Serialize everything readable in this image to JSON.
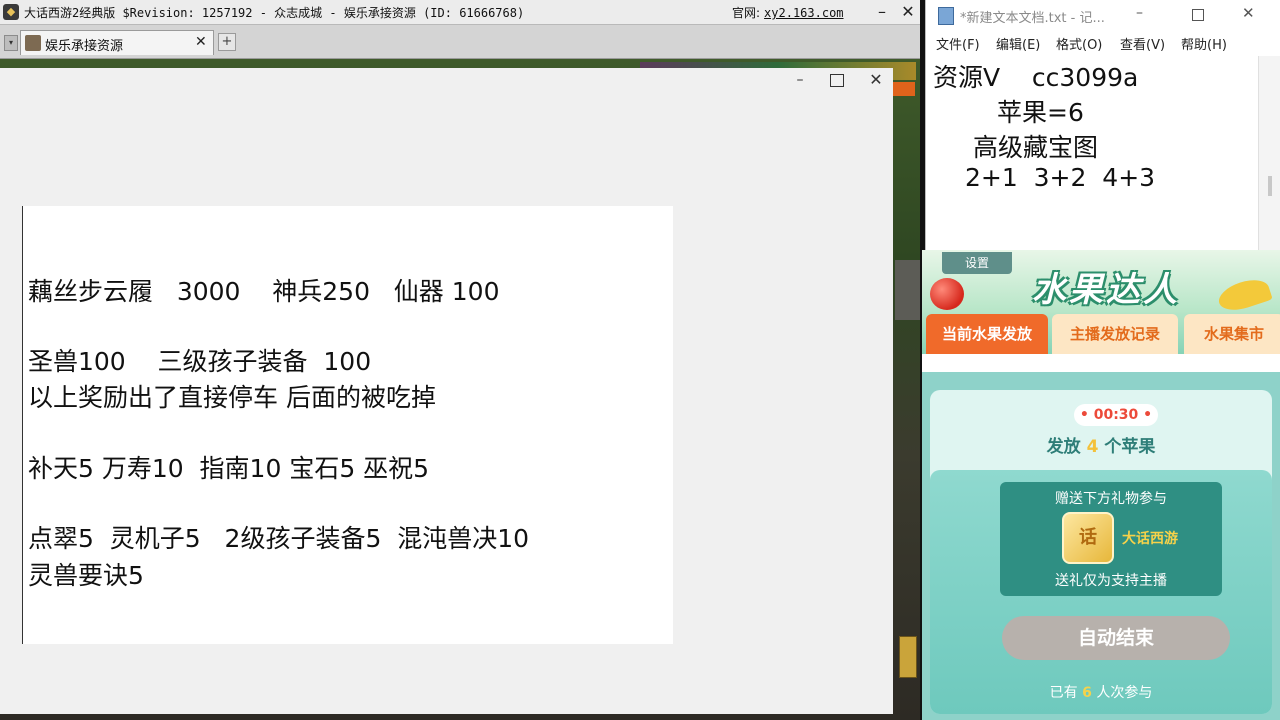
{
  "game_window": {
    "title": "大话西游2经典版 $Revision: 1257192 - 众志成城 - 娱乐承接资源 (ID: 61666768)",
    "official_label": "官网:",
    "official_url": "xy2.163.com",
    "minimize": "–",
    "close": "✕",
    "tab_label": "娱乐承接资源",
    "tab_close": "✕",
    "tab_new": "+",
    "tab_dropdown": "▾"
  },
  "overlay_window": {
    "minimize": "–",
    "close": "✕",
    "lines": [
      "藕丝步云履   3000    神兵250   仙器 100",
      "圣兽100    三级孩子装备  100",
      "以上奖励出了直接停车 后面的被吃掉",
      "补天5 万寿10  指南10 宝石5 巫祝5",
      "点翠5  灵机子5   2级孩子装备5  混沌兽决10",
      "灵兽要诀5"
    ]
  },
  "notepad": {
    "title": "*新建文本文档.txt - 记...",
    "minimize": "–",
    "close": "✕",
    "menus": [
      "文件(F)",
      "编辑(E)",
      "格式(O)",
      "查看(V)",
      "帮助(H)"
    ],
    "lines": [
      "资源V    cc3099a",
      "苹果=6",
      "高级藏宝图",
      "2+1  3+2  4+3"
    ]
  },
  "fruit_widget": {
    "settings": "设置",
    "logo": "水果达人",
    "tabs": [
      "当前水果发放",
      "主播发放记录",
      "水果集市"
    ],
    "timer": "• 00:30 •",
    "headline_prefix": "发放",
    "headline_count": "4",
    "headline_suffix": "个苹果",
    "gift_title": "赠送下方礼物参与",
    "gift_icon": "话",
    "gift_name": "大话西游",
    "gift_note": "送礼仅为支持主播",
    "auto_end": "自动结束",
    "participants_prefix": "已有",
    "participants_count": "6",
    "participants_suffix": "人次参与"
  },
  "colors": {
    "accent_orange": "#f06a2a",
    "widget_teal": "#2f8f83",
    "timer_red": "#ec4a3a"
  }
}
